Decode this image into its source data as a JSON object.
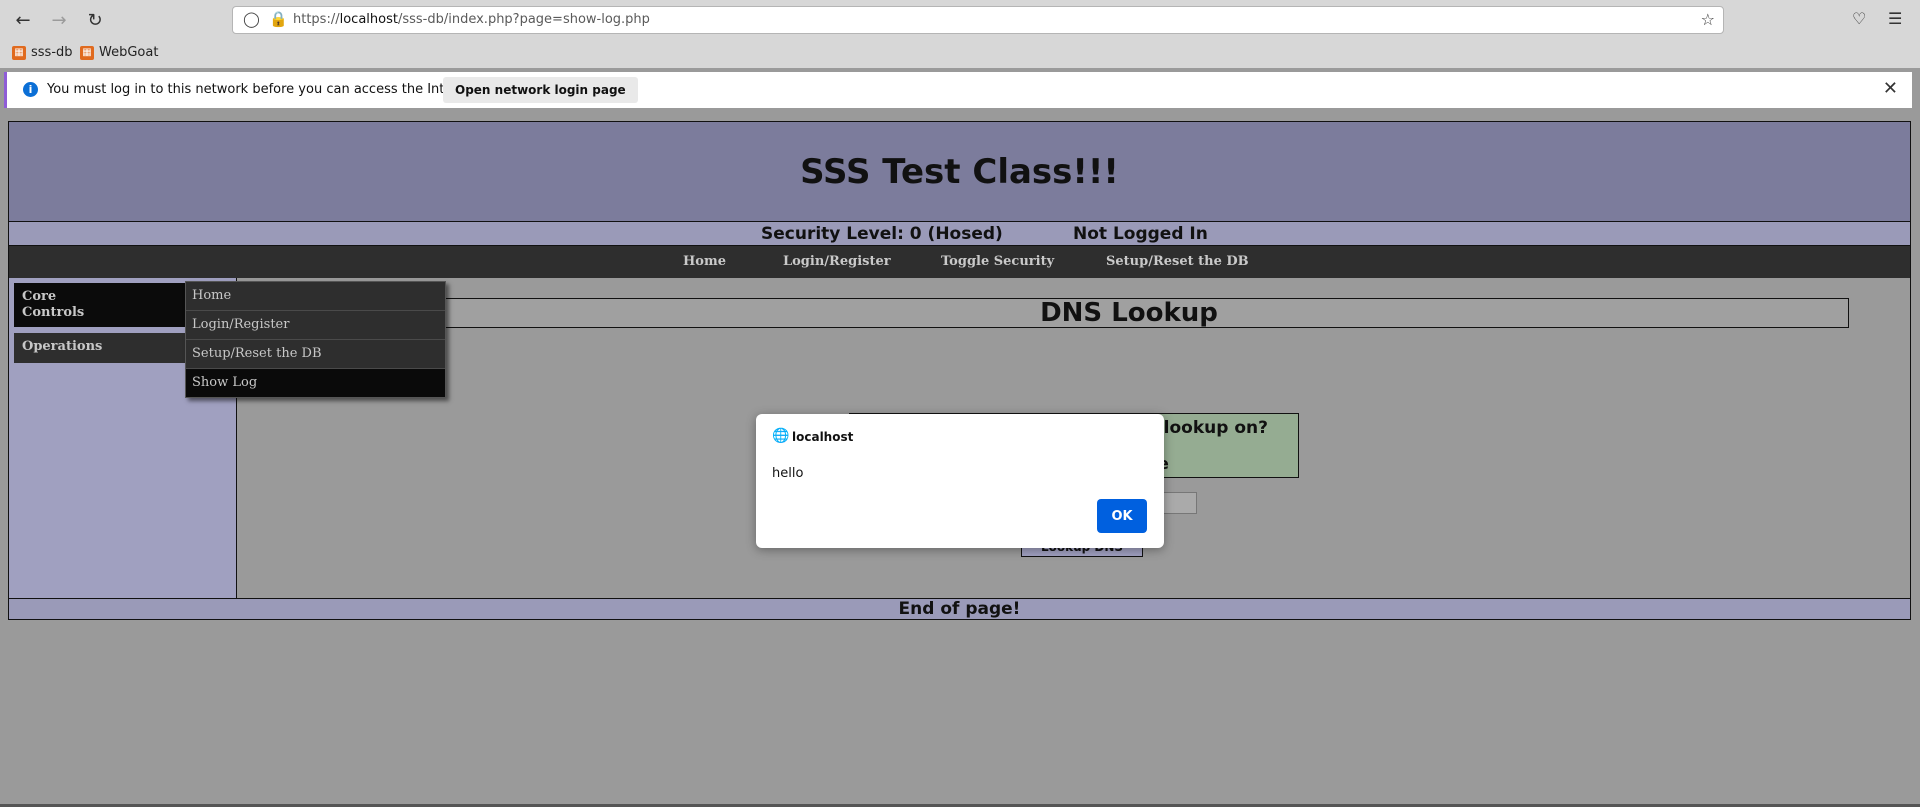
{
  "browser": {
    "url_prefix": "https://",
    "url_host": "localhost",
    "url_path": "/sss-db/index.php?page=show-log.php",
    "bookmarks": [
      {
        "label": "sss-db",
        "icon": "bookmark-favicon"
      },
      {
        "label": "WebGoat",
        "icon": "bookmark-favicon"
      }
    ]
  },
  "notification": {
    "message": "You must log in to this network before you can access the Internet.",
    "button_label": "Open network login page"
  },
  "site": {
    "title": "SSS Test Class!!!",
    "security_level": "Security Level: 0 (Hosed)",
    "login_status": "Not Logged In",
    "menu": [
      "Home",
      "Login/Register",
      "Toggle Security",
      "Setup/Reset the DB"
    ],
    "sidebar": {
      "core_line1": "Core",
      "core_line2": "Controls",
      "operations": "Operations"
    },
    "flyout": [
      "Home",
      "Login/Register",
      "Setup/Reset the DB",
      "Show Log"
    ],
    "content_title": "DNS Lookup",
    "question_fragment": "lookup on?",
    "fragment_tail": "e",
    "lookup_button": "Lookup DNS",
    "footer": "End of page!"
  },
  "dialog": {
    "title": "localhost",
    "message": "hello",
    "ok_label": "OK"
  }
}
